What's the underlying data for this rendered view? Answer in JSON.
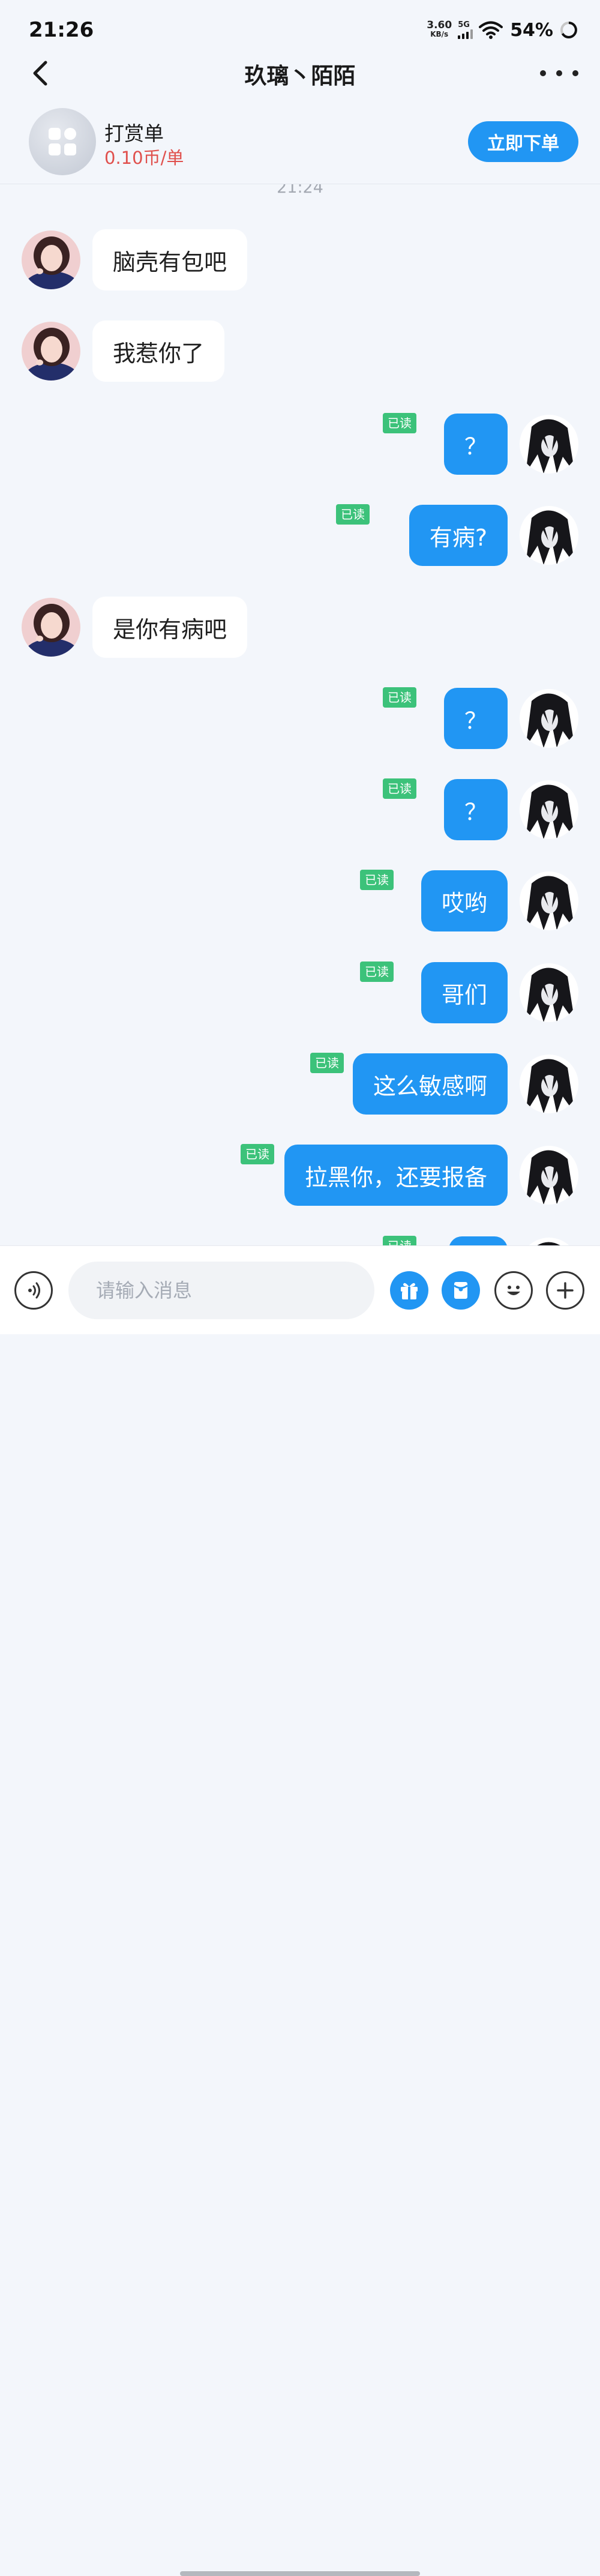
{
  "status_bar": {
    "time": "21:26",
    "net_speed_value": "3.60",
    "net_speed_unit": "KB/s",
    "network_type": "5G",
    "battery": "54%"
  },
  "header": {
    "title": "玖璃丶陌陌"
  },
  "order_bar": {
    "title": "打赏单",
    "price": "0.10币/单",
    "button_label": "立即下单"
  },
  "chat": {
    "timestamp": "21:24",
    "read_label": "已读",
    "messages": [
      {
        "from": "other",
        "text": "脑壳有包吧"
      },
      {
        "from": "other",
        "text": "我惹你了"
      },
      {
        "from": "me",
        "text": "？",
        "read": true
      },
      {
        "from": "me",
        "text": "有病?",
        "read": true
      },
      {
        "from": "other",
        "text": "是你有病吧"
      },
      {
        "from": "me",
        "text": "？",
        "read": true
      },
      {
        "from": "me",
        "text": "？",
        "read": true
      },
      {
        "from": "me",
        "text": "哎哟",
        "read": true
      },
      {
        "from": "me",
        "text": "哥们",
        "read": true
      },
      {
        "from": "me",
        "text": "这么敏感啊",
        "read": true
      },
      {
        "from": "me",
        "text": "拉黑你，还要报备",
        "read": true
      },
      {
        "from": "me",
        "text": "",
        "read": true
      }
    ]
  },
  "input_bar": {
    "placeholder": "请输入消息"
  },
  "colors": {
    "accent": "#2196f3",
    "read_tag": "#3cc27a",
    "price": "#e0504d",
    "background": "#f3f6fb"
  }
}
